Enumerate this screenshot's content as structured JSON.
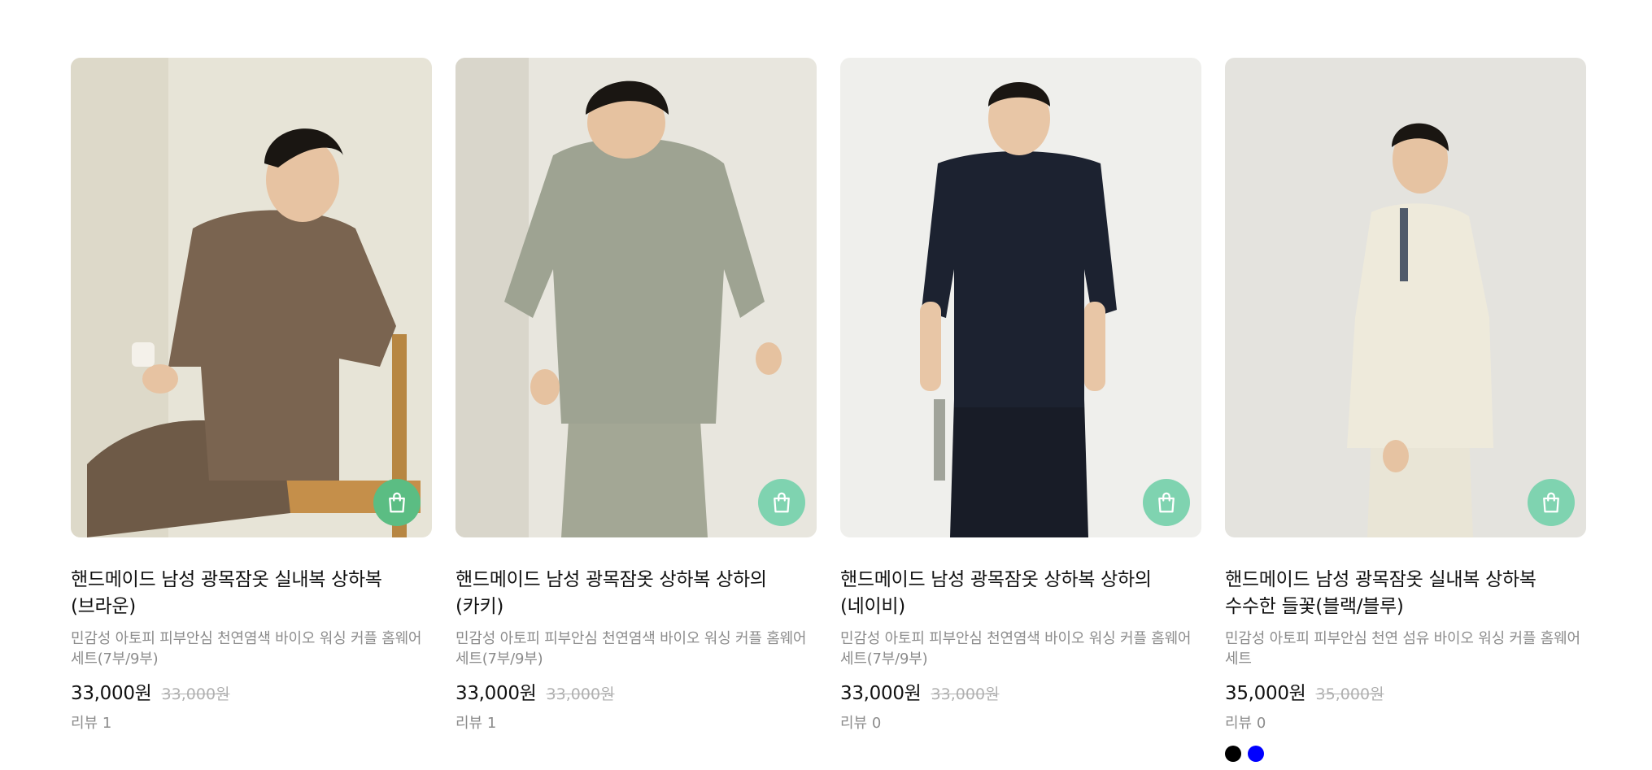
{
  "products": [
    {
      "title": "핸드메이드 남성 광목잠옷 실내복 상하복(브라운)",
      "description": "민감성 아토피 피부안심 천연염색 바이오 워싱 커플 홈웨어 세트(7부/9부)",
      "price": "33,000원",
      "original_price": "33,000원",
      "review": "리뷰 1",
      "image_alt": "brown linen loungewear",
      "garment_color": "#7a6450",
      "background_color": "#e9e6dc",
      "cart_icon": "shopping-bag-icon",
      "cart_color": "#5bbd83"
    },
    {
      "title": "핸드메이드 남성 광목잠옷 상하복 상하의(카키)",
      "description": "민감성 아토피 피부안심 천연염색 바이오 워싱 커플 홈웨어 세트(7부/9부)",
      "price": "33,000원",
      "original_price": "33,000원",
      "review": "리뷰 1",
      "image_alt": "khaki linen loungewear",
      "garment_color": "#9ea392",
      "background_color": "#e8e6df",
      "cart_icon": "shopping-bag-icon",
      "cart_color": "#7fd3b0"
    },
    {
      "title": "핸드메이드 남성 광목잠옷 상하복 상하의(네이비)",
      "description": "민감성 아토피 피부안심 천연염색 바이오 워싱 커플 홈웨어 세트(7부/9부)",
      "price": "33,000원",
      "original_price": "33,000원",
      "review": "리뷰 0",
      "image_alt": "navy linen loungewear",
      "garment_color": "#1c2230",
      "background_color": "#eeeeeb",
      "cart_icon": "shopping-bag-icon",
      "cart_color": "#7fd3b0"
    },
    {
      "title": "핸드메이드 남성 광목잠옷 실내복 상하복 수수한 들꽃(블랙/블루)",
      "description": "민감성 아토피 피부안심 천연 섬유 바이오 워싱 커플 홈웨어 세트",
      "price": "35,000원",
      "original_price": "35,000원",
      "review": "리뷰 0",
      "image_alt": "cream linen loungewear",
      "garment_color": "#eeeadb",
      "background_color": "#e5e4df",
      "cart_icon": "shopping-bag-icon",
      "cart_color": "#7fd3b0",
      "swatches": [
        "#000000",
        "#0000ff"
      ]
    }
  ]
}
